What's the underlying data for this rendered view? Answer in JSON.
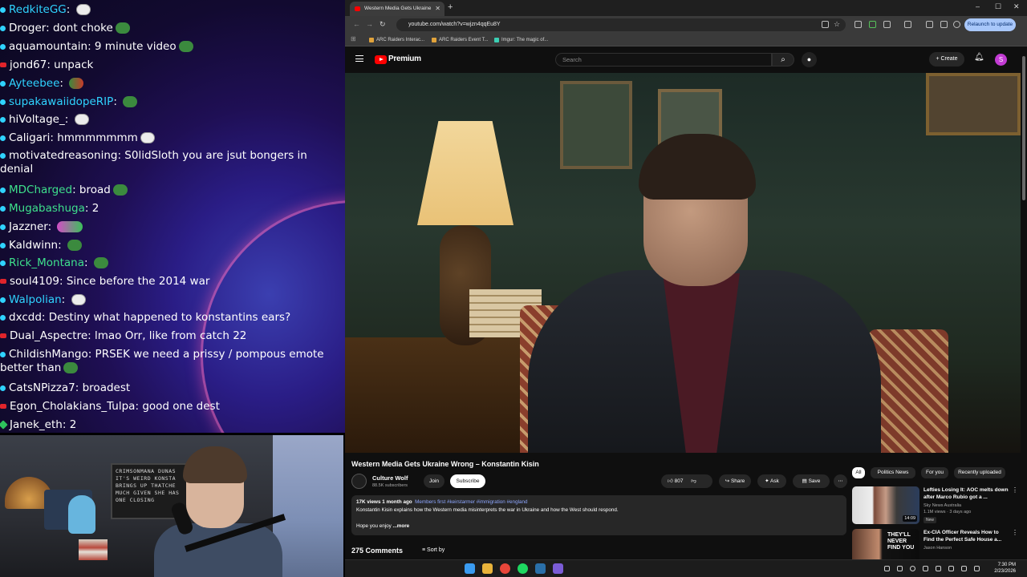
{
  "chat": {
    "messages": [
      {
        "user": "RedkiteGG",
        "text": "",
        "color": "#2fd3ff",
        "badge": "blue",
        "emote": "white"
      },
      {
        "user": "Droger",
        "text": "dont choke",
        "color": "#ffffff",
        "badge": "blue",
        "emote": "green"
      },
      {
        "user": "aquamountain",
        "text": "9 minute video",
        "color": "#ffffff",
        "badge": "blue",
        "emote": "green"
      },
      {
        "user": "jond67",
        "text": "unpack",
        "color": "#ffffff",
        "badge": "red",
        "emote": ""
      },
      {
        "user": "Ayteebee",
        "text": "",
        "color": "#2fd3ff",
        "badge": "blue",
        "emote": "multi"
      },
      {
        "user": "supakawaiidopeRIP",
        "text": "",
        "color": "#2fd3ff",
        "badge": "blue",
        "emote": "green"
      },
      {
        "user": "hiVoltage_",
        "text": "",
        "color": "#ffffff",
        "badge": "blue",
        "emote": "white"
      },
      {
        "user": "Caligari",
        "text": "hmmmmmmm",
        "color": "#ffffff",
        "badge": "blue",
        "emote": "white"
      },
      {
        "user": "motivatedreasoning",
        "text": "S0lidSloth you are jsut bongers in denial",
        "color": "#ffffff",
        "badge": "blue",
        "emote": ""
      },
      {
        "user": "MDCharged",
        "text": "broad",
        "color": "#3ee08c",
        "badge": "blue",
        "emote": "green"
      },
      {
        "user": "Mugabashuga",
        "text": "2",
        "color": "#3ee08c",
        "badge": "blue",
        "emote": ""
      },
      {
        "user": "Jazzner",
        "text": "",
        "color": "#ffffff",
        "badge": "blue",
        "emote": "pink"
      },
      {
        "user": "Kaldwinn",
        "text": "",
        "color": "#ffffff",
        "badge": "blue",
        "emote": "green"
      },
      {
        "user": "Rick_Montana",
        "text": "",
        "color": "#3ee08c",
        "badge": "blue",
        "emote": "green"
      },
      {
        "user": "soul4109",
        "text": "Since before the 2014 war",
        "color": "#ffffff",
        "badge": "red",
        "emote": ""
      },
      {
        "user": "Walpolian",
        "text": "",
        "color": "#2fd3ff",
        "badge": "blue",
        "emote": "white"
      },
      {
        "user": "dxcdd",
        "text": "Destiny what happened to konstantins ears?",
        "color": "#ffffff",
        "badge": "blue",
        "emote": ""
      },
      {
        "user": "Dual_Aspectre",
        "text": "lmao Orr, like from catch 22",
        "color": "#ffffff",
        "badge": "red",
        "emote": ""
      },
      {
        "user": "ChildishMango",
        "text": "PRSEK we need a prissy / pompous emote better than",
        "color": "#ffffff",
        "badge": "blue",
        "emote": "green"
      },
      {
        "user": "CatsNPizza7",
        "text": "broadest",
        "color": "#ffffff",
        "badge": "blue",
        "emote": ""
      },
      {
        "user": "Egon_Cholakians_Tulpa",
        "text": "good one dest",
        "color": "#ffffff",
        "badge": "red",
        "emote": ""
      },
      {
        "user": "Janek_eth",
        "text": "2",
        "color": "#ffffff",
        "badge": "green",
        "emote": ""
      }
    ]
  },
  "webcam": {
    "poster_text": "CRIMSONMANA DUNAS IT'S WEIRD KONSTA BRINGS UP THATCHE MUCH GIVEN SHE HAS ONE CLOSING"
  },
  "browser": {
    "tab_title": "Western Media Gets Ukraine",
    "tab_close": "✕",
    "new_tab": "+",
    "window_controls": [
      "–",
      "☐",
      "✕"
    ],
    "url": "youtube.com/watch?v=wjzn4qqEu8Y",
    "relaunch_label": "Relaunch to update",
    "bookmarks": [
      "ARC Raiders Interac...",
      "ARC Raiders Event T...",
      "Imgur: The magic of..."
    ]
  },
  "youtube": {
    "logo_text": "Premium",
    "search_placeholder": "Search",
    "create_label": "+ Create",
    "avatar_letter": "S",
    "video_title": "Western Media Gets Ukraine Wrong – Konstantin Kisin",
    "channel_name": "Culture Wolf",
    "subscribers": "88.5K subscribers",
    "join_label": "Join",
    "subscribe_label": "Subscribe",
    "likes": "807",
    "share_label": "Share",
    "ask_label": "Ask",
    "save_label": "Save",
    "more_label": "⋯",
    "desc_meta": "17K views  1 month ago",
    "desc_tags": "Members first  #keirstarmer #immigration #england",
    "desc_line": "Konstantin Kisin explains how the Western media misinterprets the war in Ukraine and how the West should respond.",
    "desc_hope": "Hope you enjoy",
    "desc_more": "...more",
    "comments_count": "275 Comments",
    "sort_by": "Sort by",
    "chips": [
      "All",
      "Politics News",
      "For you",
      "Recently uploaded"
    ],
    "recommendations": [
      {
        "title": "Lefties Losing It: AOC melts down after Marco Rubio got a ...",
        "channel": "Sky News Australia",
        "views": "1.1M views · 3 days ago",
        "badge": "New",
        "duration": "14:09"
      },
      {
        "title": "Ex-CIA Officer Reveals How to Find the Perfect Safe House a...",
        "channel": "Jason Hanson",
        "views": "",
        "badge": "",
        "duration": "",
        "thumb_text": "THEY'LL NEVER FIND YOU"
      }
    ]
  },
  "taskbar": {
    "time": "7:30 PM",
    "date": "2/23/2026"
  }
}
